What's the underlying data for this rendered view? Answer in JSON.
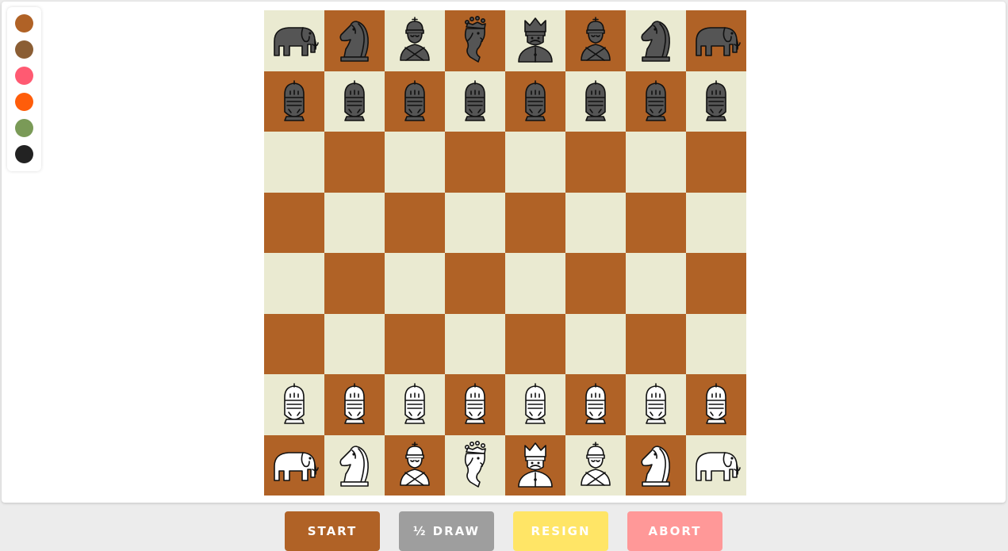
{
  "palette": [
    {
      "name": "brown",
      "color": "#b06226"
    },
    {
      "name": "dark-brown",
      "color": "#8b5e34"
    },
    {
      "name": "pink",
      "color": "#ff5a72"
    },
    {
      "name": "orange",
      "color": "#ff5d0a"
    },
    {
      "name": "olive",
      "color": "#7a9a57"
    },
    {
      "name": "black",
      "color": "#222222"
    }
  ],
  "board": {
    "light_color": "#eaead1",
    "dark_color": "#b06226",
    "black_piece_fill": "#555555",
    "white_piece_fill": "#ffffff",
    "ranks": [
      [
        {
          "piece": "elephant",
          "side": "black",
          "icon": "elephant-icon"
        },
        {
          "piece": "knight",
          "side": "black",
          "icon": "knight-icon"
        },
        {
          "piece": "bishop",
          "side": "black",
          "icon": "bishop-icon"
        },
        {
          "piece": "queen",
          "side": "black",
          "icon": "queen-icon"
        },
        {
          "piece": "king",
          "side": "black",
          "icon": "king-icon"
        },
        {
          "piece": "bishop",
          "side": "black",
          "icon": "bishop-icon"
        },
        {
          "piece": "knight",
          "side": "black",
          "icon": "knight-icon"
        },
        {
          "piece": "elephant",
          "side": "black",
          "icon": "elephant-icon"
        }
      ],
      [
        {
          "piece": "pawn",
          "side": "black",
          "icon": "knight-helmet-icon"
        },
        {
          "piece": "pawn",
          "side": "black",
          "icon": "knight-helmet-icon"
        },
        {
          "piece": "pawn",
          "side": "black",
          "icon": "knight-helmet-icon"
        },
        {
          "piece": "pawn",
          "side": "black",
          "icon": "knight-helmet-icon"
        },
        {
          "piece": "pawn",
          "side": "black",
          "icon": "knight-helmet-icon"
        },
        {
          "piece": "pawn",
          "side": "black",
          "icon": "knight-helmet-icon"
        },
        {
          "piece": "pawn",
          "side": "black",
          "icon": "knight-helmet-icon"
        },
        {
          "piece": "pawn",
          "side": "black",
          "icon": "knight-helmet-icon"
        }
      ],
      [
        null,
        null,
        null,
        null,
        null,
        null,
        null,
        null
      ],
      [
        null,
        null,
        null,
        null,
        null,
        null,
        null,
        null
      ],
      [
        null,
        null,
        null,
        null,
        null,
        null,
        null,
        null
      ],
      [
        null,
        null,
        null,
        null,
        null,
        null,
        null,
        null
      ],
      [
        {
          "piece": "pawn",
          "side": "white",
          "icon": "knight-helmet-icon"
        },
        {
          "piece": "pawn",
          "side": "white",
          "icon": "knight-helmet-icon"
        },
        {
          "piece": "pawn",
          "side": "white",
          "icon": "knight-helmet-icon"
        },
        {
          "piece": "pawn",
          "side": "white",
          "icon": "knight-helmet-icon"
        },
        {
          "piece": "pawn",
          "side": "white",
          "icon": "knight-helmet-icon"
        },
        {
          "piece": "pawn",
          "side": "white",
          "icon": "knight-helmet-icon"
        },
        {
          "piece": "pawn",
          "side": "white",
          "icon": "knight-helmet-icon"
        },
        {
          "piece": "pawn",
          "side": "white",
          "icon": "knight-helmet-icon"
        }
      ],
      [
        {
          "piece": "elephant",
          "side": "white",
          "icon": "elephant-icon"
        },
        {
          "piece": "knight",
          "side": "white",
          "icon": "knight-icon"
        },
        {
          "piece": "bishop",
          "side": "white",
          "icon": "bishop-icon"
        },
        {
          "piece": "queen",
          "side": "white",
          "icon": "queen-icon"
        },
        {
          "piece": "king",
          "side": "white",
          "icon": "king-icon"
        },
        {
          "piece": "bishop",
          "side": "white",
          "icon": "bishop-icon"
        },
        {
          "piece": "knight",
          "side": "white",
          "icon": "knight-icon"
        },
        {
          "piece": "elephant",
          "side": "white",
          "icon": "elephant-icon"
        }
      ]
    ]
  },
  "controls": {
    "start": {
      "label": "START",
      "color": "#b06226"
    },
    "draw": {
      "label": "½ DRAW",
      "color": "#9e9e9e"
    },
    "resign": {
      "label": "RESIGN",
      "color": "#ffe566"
    },
    "abort": {
      "label": "ABORT",
      "color": "#ff9898"
    }
  }
}
